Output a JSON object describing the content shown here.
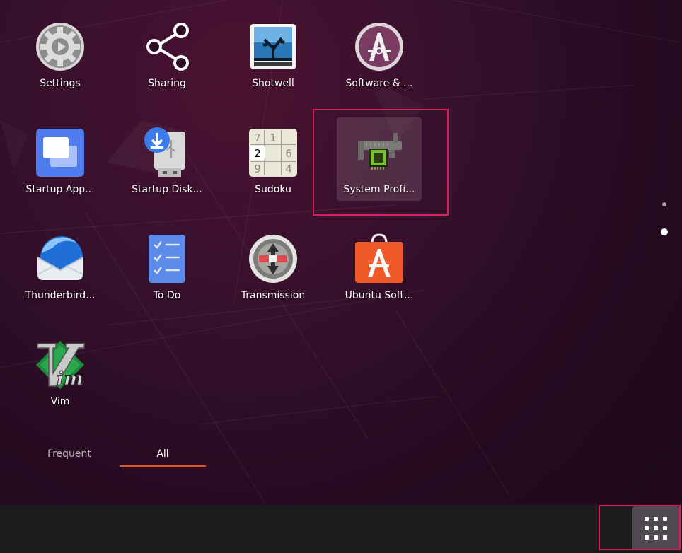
{
  "apps": [
    {
      "id": "settings",
      "label": "Settings",
      "icon": "settings-gear-icon"
    },
    {
      "id": "sharing",
      "label": "Sharing",
      "icon": "share-icon"
    },
    {
      "id": "shotwell",
      "label": "Shotwell",
      "icon": "shotwell-photo-icon"
    },
    {
      "id": "software-updater",
      "label": "Software & ...",
      "icon": "software-properties-icon"
    },
    {
      "id": "startup-apps",
      "label": "Startup App...",
      "icon": "startup-applications-icon"
    },
    {
      "id": "startup-disk",
      "label": "Startup Disk...",
      "icon": "usb-drive-download-icon"
    },
    {
      "id": "sudoku",
      "label": "Sudoku",
      "icon": "sudoku-grid-icon",
      "digits": [
        "7",
        "1",
        "2",
        "6",
        "9",
        "4"
      ]
    },
    {
      "id": "system-profiler",
      "label": "System Profi...",
      "icon": "hardware-caliper-icon",
      "selected": true
    },
    {
      "id": "thunderbird",
      "label": "Thunderbird...",
      "icon": "thunderbird-mail-icon"
    },
    {
      "id": "todo",
      "label": "To Do",
      "icon": "checklist-icon"
    },
    {
      "id": "transmission",
      "label": "Transmission",
      "icon": "transmission-torrent-icon"
    },
    {
      "id": "ubuntu-software",
      "label": "Ubuntu Soft...",
      "icon": "ubuntu-software-bag-icon"
    },
    {
      "id": "vim",
      "label": "Vim",
      "icon": "vim-logo-icon",
      "logo_text": "im"
    }
  ],
  "tabs": {
    "frequent": "Frequent",
    "all": "All",
    "active": "all"
  },
  "pagination": {
    "pages": 2,
    "current": 2
  },
  "dock": {
    "show_apps_icon": "grid-dots-icon"
  },
  "colors": {
    "accent": "#e95420",
    "annotation": "#e0185c",
    "background": "#2c0e25"
  }
}
